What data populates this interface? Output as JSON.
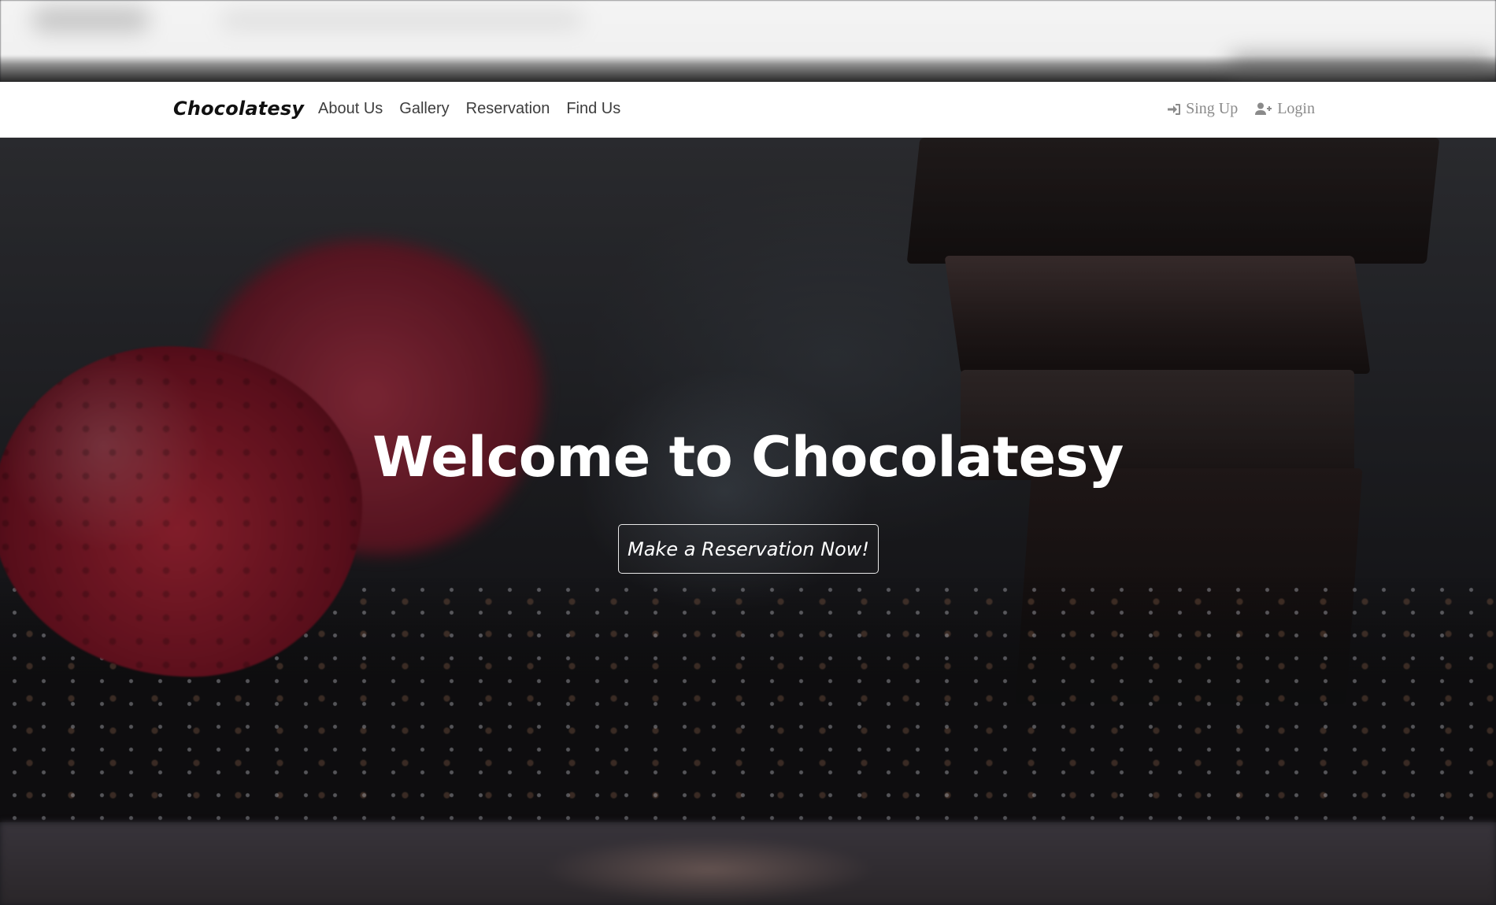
{
  "navbar": {
    "brand": "Chocolatesy",
    "links": [
      "About Us",
      "Gallery",
      "Reservation",
      "Find Us"
    ],
    "auth": {
      "signup_label": "Sing Up",
      "signup_icon": "sign-in-icon",
      "login_label": "Login",
      "login_icon": "user-plus-icon"
    }
  },
  "hero": {
    "title": "Welcome to Chocolatesy",
    "cta_label": "Make a Reservation Now!"
  },
  "colors": {
    "navbar_bg": "#ffffff",
    "brand_text": "#111111",
    "nav_link": "#3d3d3d",
    "auth_link": "#8a8a8a",
    "hero_text": "#ffffff"
  }
}
